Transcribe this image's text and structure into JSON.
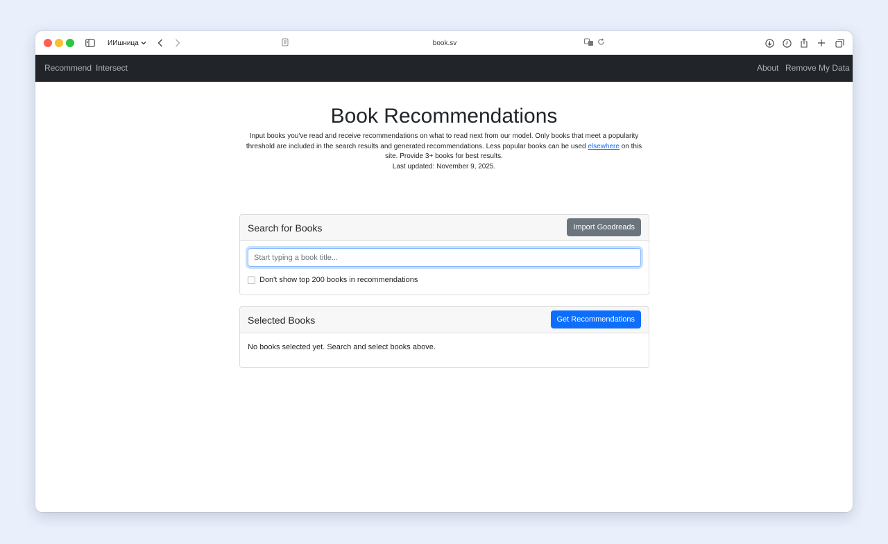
{
  "browser": {
    "profile_label": "ИИшница",
    "url": "book.sv"
  },
  "navbar": {
    "left_links": [
      "Recommend",
      "Intersect"
    ],
    "right_links": [
      "About",
      "Remove My Data"
    ]
  },
  "main": {
    "title": "Book Recommendations",
    "intro_part1": "Input books you've read and receive recommendations on what to read next from our model. Only books that meet a popularity threshold are included in the search results and generated recommendations. Less popular books can be used ",
    "intro_link": "elsewhere",
    "intro_part2": " on this site. Provide 3+ books for best results.",
    "last_updated": "Last updated: November 9, 2025."
  },
  "search_card": {
    "title": "Search for Books",
    "import_button": "Import Goodreads",
    "input_placeholder": "Start typing a book title...",
    "input_value": "",
    "checkbox_label": "Don't show top 200 books in recommendations",
    "checkbox_checked": false
  },
  "selected_card": {
    "title": "Selected Books",
    "recommend_button": "Get Recommendations",
    "empty_message": "No books selected yet. Search and select books above."
  }
}
